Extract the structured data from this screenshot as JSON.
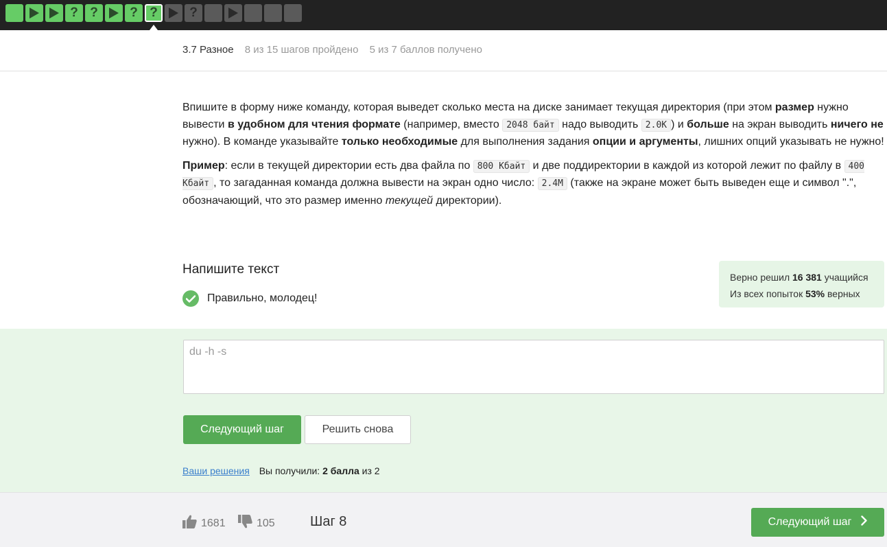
{
  "steps": [
    {
      "kind": "text",
      "status": "done",
      "icon": "square-icon"
    },
    {
      "kind": "video",
      "status": "done",
      "icon": "play-icon"
    },
    {
      "kind": "video",
      "status": "done",
      "icon": "play-icon"
    },
    {
      "kind": "quiz",
      "status": "done",
      "label": "?"
    },
    {
      "kind": "quiz",
      "status": "done",
      "label": "?"
    },
    {
      "kind": "video",
      "status": "done",
      "icon": "play-icon"
    },
    {
      "kind": "quiz",
      "status": "done",
      "label": "?"
    },
    {
      "kind": "quiz",
      "status": "current",
      "label": "?"
    },
    {
      "kind": "video",
      "status": "todo",
      "icon": "play-icon"
    },
    {
      "kind": "quiz",
      "status": "todo",
      "label": "?"
    },
    {
      "kind": "text",
      "status": "todo",
      "icon": "square-icon"
    },
    {
      "kind": "video",
      "status": "todo",
      "icon": "play-icon"
    },
    {
      "kind": "text",
      "status": "todo",
      "icon": "square-icon"
    },
    {
      "kind": "text",
      "status": "todo",
      "icon": "square-icon"
    },
    {
      "kind": "text",
      "status": "todo",
      "icon": "square-icon"
    }
  ],
  "lesson": {
    "name": "3.7 Разное",
    "steps_progress": "8 из 15 шагов пройдено",
    "points_progress": "5 из 7 баллов  получено"
  },
  "task": {
    "p1": {
      "t1": "Впишите в форму ниже команду, которая выведет сколько места на диске занимает текущая директория (при этом ",
      "b1": "размер",
      "t2": " нужно вывести ",
      "b2": "в удобном для чтения формате",
      "t3": " (например, вместо ",
      "code1": "2048 байт",
      "t4": " надо выводить ",
      "code2": "2.0K",
      "t5": ") и ",
      "b3": "больше",
      "t6": " на экран выводить ",
      "b4": "ничего не",
      "t7": " нужно). В команде указывайте ",
      "b5": "только необходимые",
      "t8": " для выполнения задания ",
      "b6": "опции и аргументы",
      "t9": ", лишних опций указывать не нужно!"
    },
    "p2": {
      "b1": "Пример",
      "t1": ": если в текущей директории есть два файла по ",
      "code1": "800 Кбайт",
      "t2": " и две поддиректории в каждой из которой лежит по файлу в ",
      "code2": "400 Кбайт",
      "t3": ", то загаданная команда должна вывести на экран одно число: ",
      "code3": "2.4M",
      "t4": " (также на экране может быть выведен еще и символ \".\", обозначающий, что это размер именно ",
      "i1": "текущей",
      "t5": " директории)."
    }
  },
  "answer": {
    "title": "Напишите текст",
    "status_message": "Правильно, молодец!",
    "value": "du -h -s"
  },
  "stats": {
    "solved_prefix": "Верно решил ",
    "solved_count": "16 381",
    "solved_suffix": " учащийся",
    "attempts_prefix": "Из всех попыток ",
    "attempts_percent": "53%",
    "attempts_suffix": " верных"
  },
  "buttons": {
    "next_step": "Следующий шаг",
    "solve_again": "Решить снова",
    "next_step_footer": "Следующий шаг"
  },
  "solutions": {
    "link": "Ваши решения",
    "score_prefix": "Вы получили: ",
    "score_value": "2 балла",
    "score_suffix": " из 2"
  },
  "footer": {
    "likes": "1681",
    "dislikes": "105",
    "step_label": "Шаг 8"
  },
  "colors": {
    "topbar": "#222222",
    "step_done": "#66cc66",
    "step_todo": "#5a5a5a",
    "accent_green": "#55aa55",
    "green_zone": "#e8f6e8",
    "link": "#3a7fcc"
  }
}
